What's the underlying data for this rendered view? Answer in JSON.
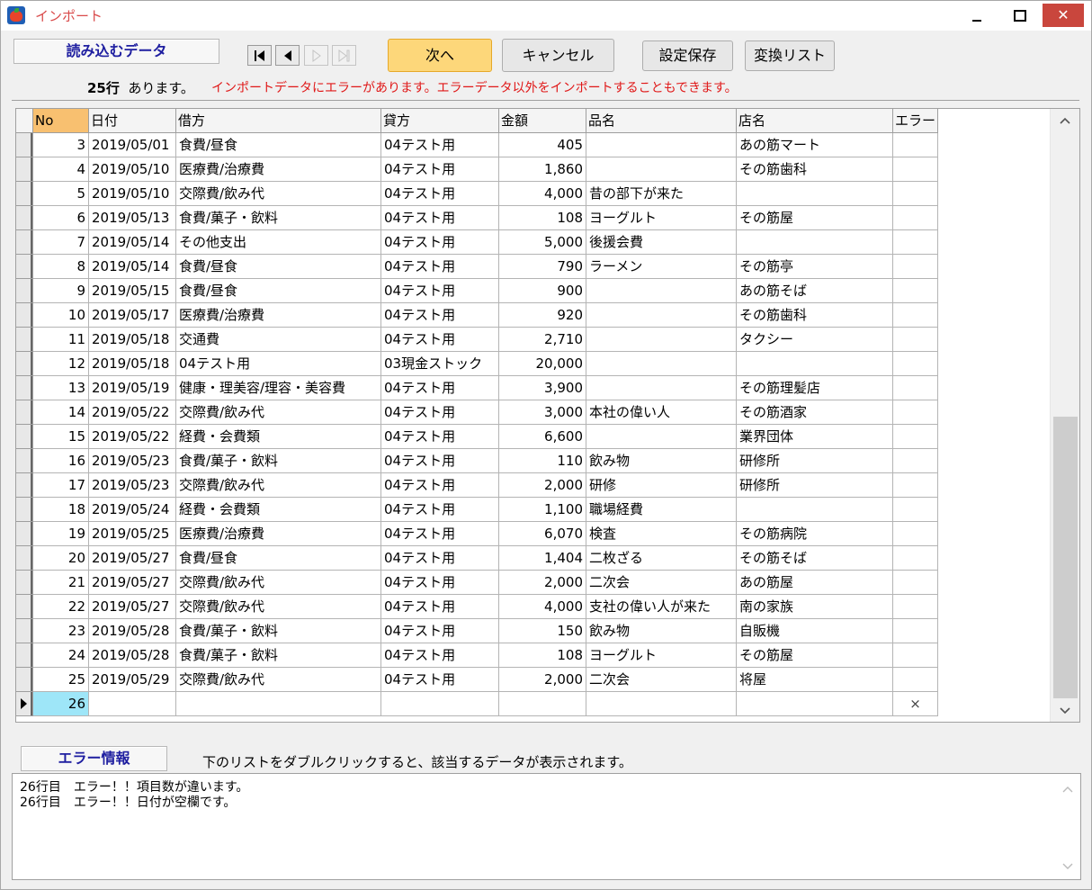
{
  "window": {
    "title": "インポート",
    "minimize": "–",
    "maximize": "□",
    "close": "✕"
  },
  "toolbar": {
    "data_label": "読み込むデータ",
    "nav_icons": [
      "first-icon",
      "prev-icon",
      "next-icon",
      "last-icon"
    ],
    "next_label": "次へ",
    "cancel_label": "キャンセル",
    "save_settings_label": "設定保存",
    "convert_list_label": "変換リスト"
  },
  "summary": {
    "count": "25行",
    "suffix": "あります。",
    "error_message": "インポートデータにエラーがあります。エラーデータ以外をインポートすることもできます。"
  },
  "grid": {
    "columns": [
      "No",
      "日付",
      "借方",
      "貸方",
      "金額",
      "品名",
      "店名",
      "エラー"
    ],
    "rows": [
      [
        "3",
        "2019/05/01",
        "食費/昼食",
        "04テスト用",
        "405",
        "",
        "あの筋マート",
        ""
      ],
      [
        "4",
        "2019/05/10",
        "医療費/治療費",
        "04テスト用",
        "1,860",
        "",
        "その筋歯科",
        ""
      ],
      [
        "5",
        "2019/05/10",
        "交際費/飲み代",
        "04テスト用",
        "4,000",
        "昔の部下が来た",
        "",
        ""
      ],
      [
        "6",
        "2019/05/13",
        "食費/菓子・飲料",
        "04テスト用",
        "108",
        "ヨーグルト",
        "その筋屋",
        ""
      ],
      [
        "7",
        "2019/05/14",
        "その他支出",
        "04テスト用",
        "5,000",
        "後援会費",
        "",
        ""
      ],
      [
        "8",
        "2019/05/14",
        "食費/昼食",
        "04テスト用",
        "790",
        "ラーメン",
        "その筋亭",
        ""
      ],
      [
        "9",
        "2019/05/15",
        "食費/昼食",
        "04テスト用",
        "900",
        "",
        "あの筋そば",
        ""
      ],
      [
        "10",
        "2019/05/17",
        "医療費/治療費",
        "04テスト用",
        "920",
        "",
        "その筋歯科",
        ""
      ],
      [
        "11",
        "2019/05/18",
        "交通費",
        "04テスト用",
        "2,710",
        "",
        "タクシー",
        ""
      ],
      [
        "12",
        "2019/05/18",
        "04テスト用",
        "03現金ストック",
        "20,000",
        "",
        "",
        ""
      ],
      [
        "13",
        "2019/05/19",
        "健康・理美容/理容・美容費",
        "04テスト用",
        "3,900",
        "",
        "その筋理髪店",
        ""
      ],
      [
        "14",
        "2019/05/22",
        "交際費/飲み代",
        "04テスト用",
        "3,000",
        "本社の偉い人",
        "その筋酒家",
        ""
      ],
      [
        "15",
        "2019/05/22",
        "経費・会費類",
        "04テスト用",
        "6,600",
        "",
        "業界団体",
        ""
      ],
      [
        "16",
        "2019/05/23",
        "食費/菓子・飲料",
        "04テスト用",
        "110",
        "飲み物",
        "研修所",
        ""
      ],
      [
        "17",
        "2019/05/23",
        "交際費/飲み代",
        "04テスト用",
        "2,000",
        "研修",
        "研修所",
        ""
      ],
      [
        "18",
        "2019/05/24",
        "経費・会費類",
        "04テスト用",
        "1,100",
        "職場経費",
        "",
        ""
      ],
      [
        "19",
        "2019/05/25",
        "医療費/治療費",
        "04テスト用",
        "6,070",
        "検査",
        "その筋病院",
        ""
      ],
      [
        "20",
        "2019/05/27",
        "食費/昼食",
        "04テスト用",
        "1,404",
        "二枚ざる",
        "その筋そば",
        ""
      ],
      [
        "21",
        "2019/05/27",
        "交際費/飲み代",
        "04テスト用",
        "2,000",
        "二次会",
        "あの筋屋",
        ""
      ],
      [
        "22",
        "2019/05/27",
        "交際費/飲み代",
        "04テスト用",
        "4,000",
        "支社の偉い人が来た",
        "南の家族",
        ""
      ],
      [
        "23",
        "2019/05/28",
        "食費/菓子・飲料",
        "04テスト用",
        "150",
        "飲み物",
        "自販機",
        ""
      ],
      [
        "24",
        "2019/05/28",
        "食費/菓子・飲料",
        "04テスト用",
        "108",
        "ヨーグルト",
        "その筋屋",
        ""
      ],
      [
        "25",
        "2019/05/29",
        "交際費/飲み代",
        "04テスト用",
        "2,000",
        "二次会",
        "将屋",
        ""
      ],
      [
        "26",
        "",
        "",
        "",
        "",
        "",
        "",
        "×"
      ]
    ],
    "current_row": 23
  },
  "error_info": {
    "label": "エラー情報",
    "hint": "下のリストをダブルクリックすると、該当するデータが表示されます。",
    "lines": [
      "26行目　エラー！！項目数が違います。",
      "26行目　エラー！！日付が空欄です。"
    ]
  }
}
